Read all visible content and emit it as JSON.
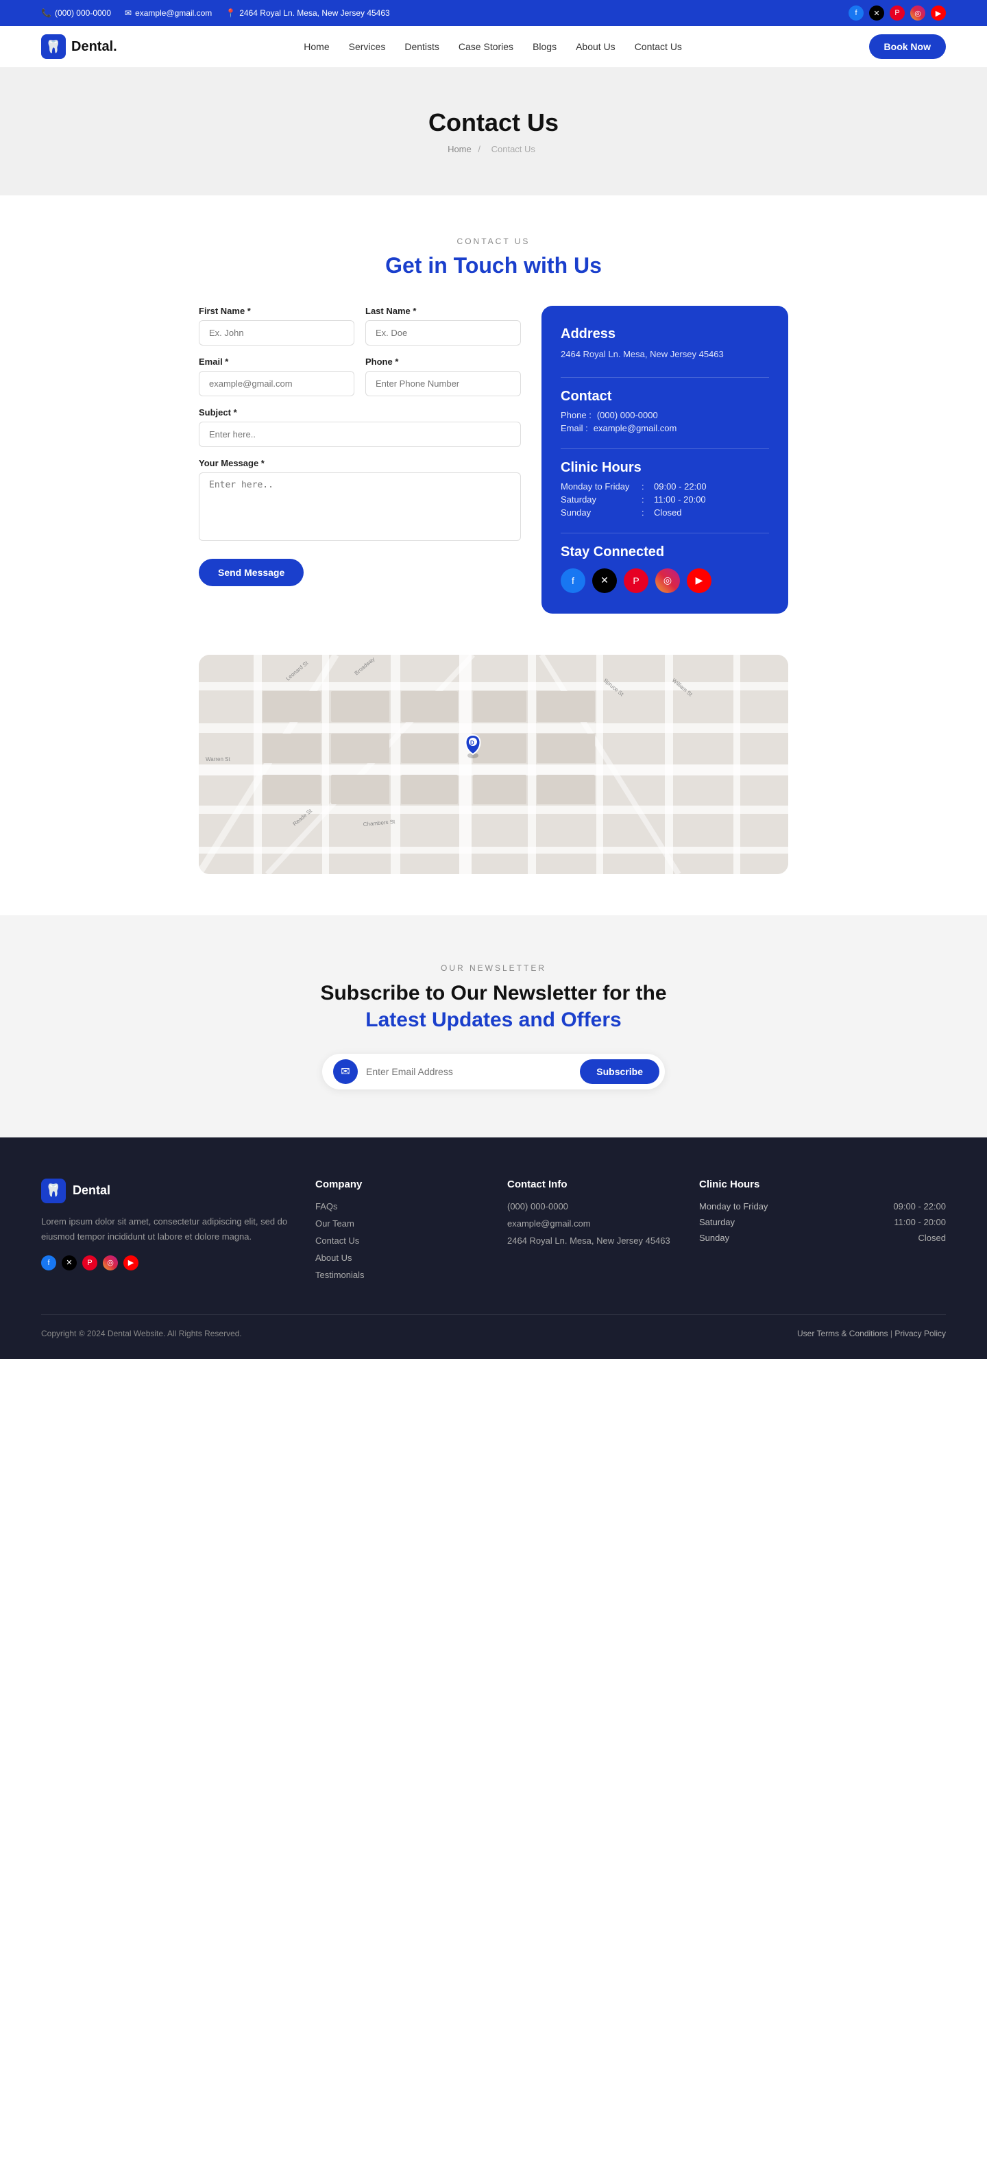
{
  "topbar": {
    "phone": "(000) 000-0000",
    "email": "example@gmail.com",
    "address": "2464 Royal Ln. Mesa, New Jersey 45463"
  },
  "navbar": {
    "logo": "Dental.",
    "links": [
      "Home",
      "Services",
      "Dentists",
      "Case Stories",
      "Blogs",
      "About Us",
      "Contact Us"
    ],
    "cta": "Book Now"
  },
  "hero": {
    "title": "Contact Us",
    "breadcrumb_home": "Home",
    "breadcrumb_current": "Contact Us"
  },
  "contact": {
    "section_label": "CONTACT US",
    "section_title_part1": "Get in Touch",
    "section_title_part2": " with Us",
    "form": {
      "first_name_label": "First Name *",
      "first_name_placeholder": "Ex. John",
      "last_name_label": "Last Name *",
      "last_name_placeholder": "Ex. Doe",
      "email_label": "Email *",
      "email_placeholder": "example@gmail.com",
      "phone_label": "Phone *",
      "phone_placeholder": "Enter Phone Number",
      "subject_label": "Subject *",
      "subject_placeholder": "Enter here..",
      "message_label": "Your Message *",
      "message_placeholder": "Enter here..",
      "send_button": "Send Message"
    },
    "info": {
      "address_title": "Address",
      "address_text": "2464 Royal Ln. Mesa, New Jersey 45463",
      "contact_title": "Contact",
      "phone_label": "Phone",
      "phone_value": "(000) 000-0000",
      "email_label": "Email",
      "email_value": "example@gmail.com",
      "hours_title": "Clinic Hours",
      "hours": [
        {
          "day": "Monday to Friday",
          "time": "09:00 - 22:00"
        },
        {
          "day": "Saturday",
          "time": "11:00 - 20:00"
        },
        {
          "day": "Sunday",
          "time": "Closed"
        }
      ],
      "social_title": "Stay Connected"
    }
  },
  "newsletter": {
    "section_label": "OUR NEWSLETTER",
    "title_part1": "Subscribe to Our Newsletter for the ",
    "title_highlight": "Latest Updates and Offers",
    "email_placeholder": "Enter Email Address",
    "subscribe_button": "Subscribe"
  },
  "footer": {
    "logo": "Dental",
    "description": "Lorem ipsum dolor sit amet, consectetur adipiscing elit, sed do eiusmod tempor incididunt ut labore et dolore magna.",
    "company": {
      "title": "Company",
      "links": [
        "FAQs",
        "Our Team",
        "Contact Us",
        "About Us",
        "Testimonials"
      ]
    },
    "contact_info": {
      "title": "Contact Info",
      "phone": "(000) 000-0000",
      "email": "example@gmail.com",
      "address": "2464 Royal Ln. Mesa, New Jersey 45463"
    },
    "clinic_hours": {
      "title": "Clinic Hours",
      "hours": [
        {
          "day": "Monday to Friday",
          "time": "09:00 - 22:00"
        },
        {
          "day": "Saturday",
          "time": "11:00 - 20:00"
        },
        {
          "day": "Sunday",
          "time": "Closed"
        }
      ]
    },
    "copyright": "Copyright © 2024 Dental Website. All Rights Reserved.",
    "terms": "User Terms & Conditions",
    "privacy": "Privacy Policy"
  }
}
